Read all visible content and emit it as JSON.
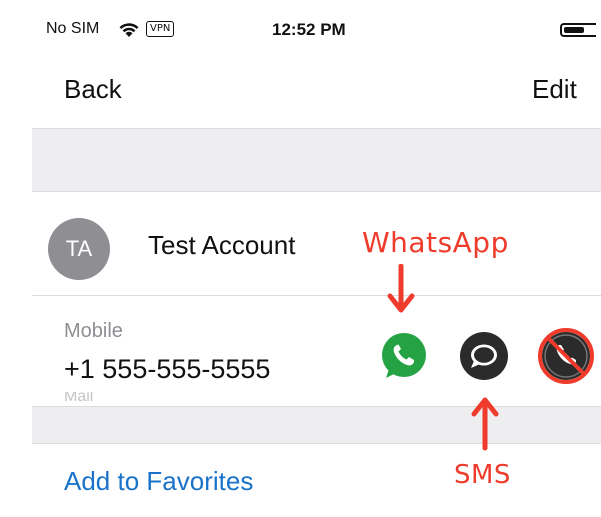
{
  "status_bar": {
    "carrier": "No SIM",
    "vpn_badge": "VPN",
    "time": "12:52 PM"
  },
  "nav": {
    "back_label": "Back",
    "edit_label": "Edit"
  },
  "contact": {
    "initials": "TA",
    "name": "Test Account"
  },
  "phone": {
    "type_label": "Mobile",
    "number": "+1 555-555-5555",
    "faint_label": "Mail"
  },
  "actions": [
    {
      "name": "whatsapp",
      "icon": "whatsapp-icon",
      "color": "#25a244"
    },
    {
      "name": "sms",
      "icon": "message-bubble-icon",
      "color": "#2b2b2b"
    },
    {
      "name": "call",
      "icon": "phone-icon",
      "color": "#2b2b2b",
      "crossed_out": true
    }
  ],
  "links": {
    "add_to_favorites": "Add to Favorites"
  },
  "annotations": {
    "whatsapp_label": "WhatsApp",
    "sms_label": "SMS",
    "color": "#ee3b2b"
  },
  "colors": {
    "link_blue": "#1a73c9",
    "separator_gray": "#eeeef0",
    "avatar_gray": "#8e8e93"
  }
}
